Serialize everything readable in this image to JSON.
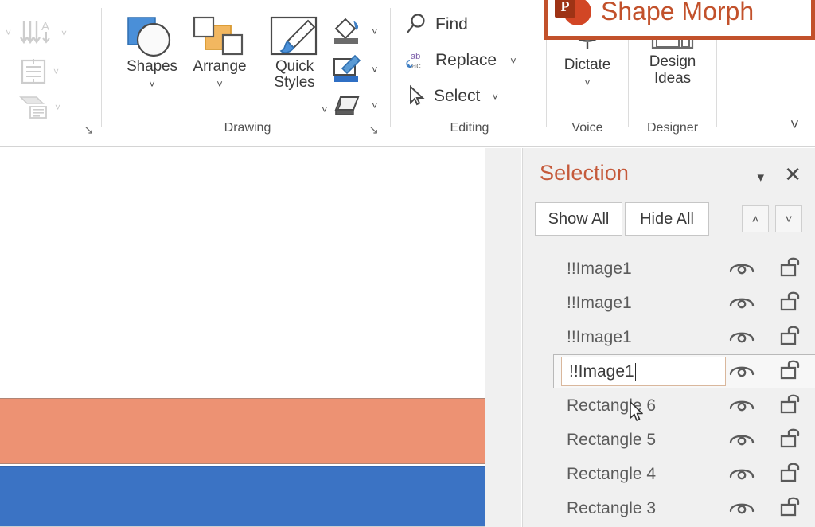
{
  "ribbon": {
    "paragraph_group": {
      "icons": [
        {
          "name": "bullets-icon",
          "chevron": "˅"
        },
        {
          "name": "text-direction-icon",
          "chevron": "˅"
        },
        {
          "name": "align-text-icon",
          "chevron": "˅"
        },
        {
          "name": "convert-to-smartart-icon",
          "chevron": "˅"
        }
      ],
      "dialog_launcher": "↘"
    },
    "drawing_group": {
      "label": "Drawing",
      "dialog_launcher": "↘",
      "buttons": [
        {
          "name": "shapes-button",
          "label": "Shapes",
          "chevron": "˅"
        },
        {
          "name": "arrange-button",
          "label": "Arrange",
          "chevron": "˅"
        },
        {
          "name": "quick-styles-button",
          "label": "Quick Styles",
          "chevron": "˅"
        }
      ],
      "small_buttons": [
        {
          "name": "shape-fill-button",
          "chevron": "˅"
        },
        {
          "name": "shape-outline-button",
          "chevron": "˅"
        },
        {
          "name": "shape-effects-button",
          "chevron": "˅"
        }
      ]
    },
    "editing_group": {
      "label": "Editing",
      "items": [
        {
          "name": "find-button",
          "label": "Find",
          "chevron": ""
        },
        {
          "name": "replace-button",
          "label": "Replace",
          "chevron": "˅"
        },
        {
          "name": "select-button",
          "label": "Select",
          "chevron": "˅"
        }
      ]
    },
    "voice_group": {
      "label": "Voice",
      "button": {
        "name": "dictate-button",
        "label": "Dictate",
        "chevron": "˅"
      }
    },
    "designer_group": {
      "label": "Designer",
      "button": {
        "name": "design-ideas-button",
        "label_line1": "Design",
        "label_line2": "Ideas"
      }
    },
    "collapse_chevron": "˅"
  },
  "banner": {
    "title": "Shape Morph",
    "logo_letter": "P",
    "border_color": "#C2512B",
    "text_color": "#C2512B"
  },
  "slide": {
    "shapes": [
      {
        "name": "orange-rectangle",
        "color": "#ED9273"
      },
      {
        "name": "blue-rectangle",
        "color": "#3B73C4"
      }
    ]
  },
  "selection_pane": {
    "title": "Selection",
    "title_color": "#C55A3B",
    "collapse_caret": "▾",
    "close_label": "✕",
    "show_all_label": "Show All",
    "hide_all_label": "Hide All",
    "move_up_label": "˄",
    "move_down_label": "˅",
    "items": [
      {
        "name": "!!Image1",
        "editing": false
      },
      {
        "name": "!!Image1",
        "editing": false
      },
      {
        "name": "!!Image1",
        "editing": false
      },
      {
        "name": "!!Image1",
        "editing": true
      },
      {
        "name": "Rectangle 6",
        "editing": false
      },
      {
        "name": "Rectangle 5",
        "editing": false
      },
      {
        "name": "Rectangle 4",
        "editing": false
      },
      {
        "name": "Rectangle 3",
        "editing": false
      }
    ]
  }
}
